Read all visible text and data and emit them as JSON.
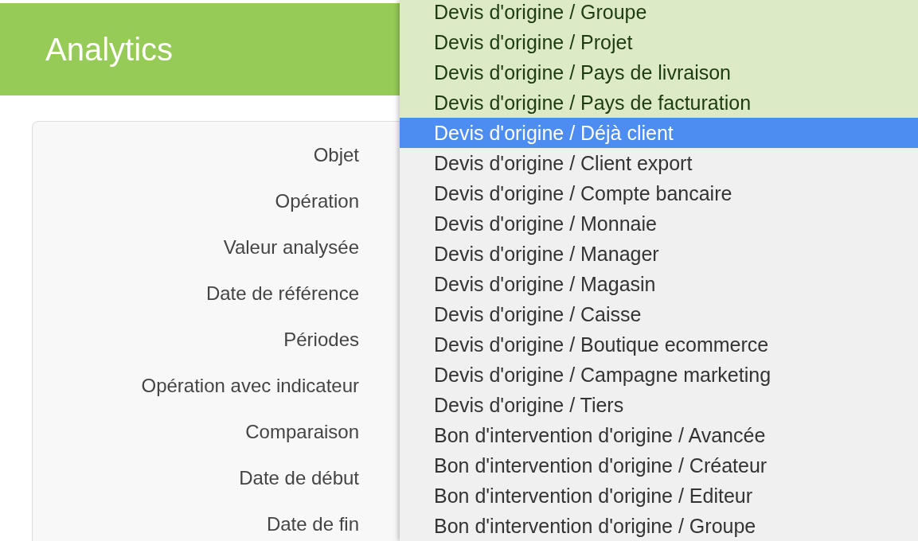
{
  "header": {
    "title": "Analytics"
  },
  "form": {
    "labels": [
      "Objet",
      "Opération",
      "Valeur analysée",
      "Date de référence",
      "Périodes",
      "Opération avec indicateur",
      "Comparaison",
      "Date de début",
      "Date de fin"
    ]
  },
  "dropdown": {
    "items": [
      {
        "label": "Devis d'origine / Groupe",
        "selected": true,
        "highlighted": false
      },
      {
        "label": "Devis d'origine / Projet",
        "selected": true,
        "highlighted": false
      },
      {
        "label": "Devis d'origine / Pays de livraison",
        "selected": true,
        "highlighted": false
      },
      {
        "label": "Devis d'origine / Pays de facturation",
        "selected": true,
        "highlighted": false
      },
      {
        "label": "Devis d'origine / Déjà client",
        "selected": false,
        "highlighted": true
      },
      {
        "label": "Devis d'origine / Client export",
        "selected": false,
        "highlighted": false
      },
      {
        "label": "Devis d'origine / Compte bancaire",
        "selected": false,
        "highlighted": false
      },
      {
        "label": "Devis d'origine / Monnaie",
        "selected": false,
        "highlighted": false
      },
      {
        "label": "Devis d'origine / Manager",
        "selected": false,
        "highlighted": false
      },
      {
        "label": "Devis d'origine / Magasin",
        "selected": false,
        "highlighted": false
      },
      {
        "label": "Devis d'origine / Caisse",
        "selected": false,
        "highlighted": false
      },
      {
        "label": "Devis d'origine / Boutique ecommerce",
        "selected": false,
        "highlighted": false
      },
      {
        "label": "Devis d'origine / Campagne marketing",
        "selected": false,
        "highlighted": false
      },
      {
        "label": "Devis d'origine / Tiers",
        "selected": false,
        "highlighted": false
      },
      {
        "label": "Bon d'intervention d'origine / Avancée",
        "selected": false,
        "highlighted": false
      },
      {
        "label": "Bon d'intervention d'origine / Créateur",
        "selected": false,
        "highlighted": false
      },
      {
        "label": "Bon d'intervention d'origine / Editeur",
        "selected": false,
        "highlighted": false
      },
      {
        "label": "Bon d'intervention d'origine / Groupe",
        "selected": false,
        "highlighted": false
      }
    ]
  }
}
